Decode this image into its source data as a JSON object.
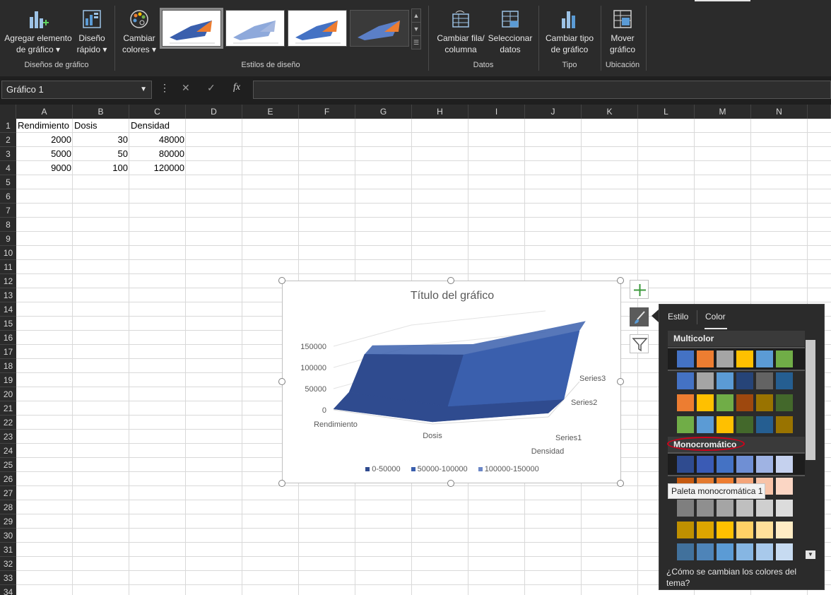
{
  "ribbon": {
    "buttons": {
      "add_element": "Agregar elemento\nde gráfico ▾",
      "add_element_l1": "Agregar elemento",
      "add_element_l2": "de gráfico ▾",
      "quick_layout_l1": "Diseño",
      "quick_layout_l2": "rápido ▾",
      "change_colors_l1": "Cambiar",
      "change_colors_l2": "colores ▾",
      "switch_row_l1": "Cambiar fila/",
      "switch_row_l2": "columna",
      "select_data_l1": "Seleccionar",
      "select_data_l2": "datos",
      "change_type_l1": "Cambiar tipo",
      "change_type_l2": "de gráfico",
      "move_chart_l1": "Mover",
      "move_chart_l2": "gráfico"
    },
    "groups": {
      "layouts": "Diseños de gráfico",
      "styles": "Estilos de diseño",
      "data": "Datos",
      "type": "Tipo",
      "location": "Ubicación"
    }
  },
  "formula_bar": {
    "name_box": "Gráfico 1",
    "more": "⋮",
    "cancel": "✕",
    "enter": "✓",
    "fx": "fx"
  },
  "sheet": {
    "columns": [
      "A",
      "B",
      "C",
      "D",
      "E",
      "F",
      "G",
      "H",
      "I",
      "J",
      "K",
      "L",
      "M",
      "N"
    ],
    "rows": [
      "1",
      "2",
      "3",
      "4",
      "5",
      "6",
      "7",
      "8",
      "9",
      "10",
      "11",
      "12",
      "13",
      "14",
      "15",
      "16",
      "17",
      "18",
      "19",
      "20",
      "21",
      "22",
      "23",
      "24",
      "25",
      "26",
      "27",
      "28",
      "29",
      "30",
      "31",
      "32",
      "33",
      "34"
    ],
    "header": [
      "Rendimiento",
      "Dosis",
      "Densidad"
    ],
    "data": [
      [
        "2000",
        "30",
        "48000"
      ],
      [
        "5000",
        "50",
        "80000"
      ],
      [
        "9000",
        "100",
        "120000"
      ]
    ]
  },
  "chart": {
    "title": "Título del gráfico",
    "y_ticks": [
      "150000",
      "100000",
      "50000",
      "0"
    ],
    "x_categories": [
      "Rendimiento",
      "Dosis",
      "Densidad"
    ],
    "depth_series": [
      "Series3",
      "Series2",
      "Series1"
    ],
    "legend": [
      "0-50000",
      "50000-100000",
      "100000-150000"
    ],
    "colors": {
      "band1": "#2f4b8f",
      "band2": "#3a5fad",
      "band3": "#6b87c7"
    }
  },
  "chart_data": {
    "type": "area",
    "title": "Título del gráfico",
    "categories": [
      "Rendimiento",
      "Dosis",
      "Densidad"
    ],
    "series": [
      {
        "name": "Series1",
        "values": [
          2000,
          5000,
          9000
        ]
      },
      {
        "name": "Series2",
        "values": [
          30,
          50,
          100
        ]
      },
      {
        "name": "Series3",
        "values": [
          48000,
          80000,
          120000
        ]
      }
    ],
    "ylim": [
      0,
      150000
    ],
    "legend_entries": [
      "0-50000",
      "50000-100000",
      "100000-150000"
    ],
    "legend_position": "bottom"
  },
  "color_panel": {
    "tab_style": "Estilo",
    "tab_color": "Color",
    "multicolor": "Multicolor",
    "monochrome": "Monocromático",
    "tooltip": "Paleta monocromática 1",
    "footer": "¿Cómo se cambian los colores del tema?",
    "multicolor_rows": [
      [
        "#4472c4",
        "#ed7d31",
        "#a5a5a5",
        "#ffc000",
        "#5b9bd5",
        "#70ad47"
      ],
      [
        "#4472c4",
        "#a5a5a5",
        "#5b9bd5",
        "#264478",
        "#636363",
        "#255e91"
      ],
      [
        "#ed7d31",
        "#ffc000",
        "#70ad47",
        "#9e480e",
        "#997300",
        "#43682b"
      ],
      [
        "#70ad47",
        "#5b9bd5",
        "#ffc000",
        "#43682b",
        "#255e91",
        "#997300"
      ]
    ],
    "mono_rows": [
      [
        "#2f4b8f",
        "#3a5bb5",
        "#4472c4",
        "#6f8fd4",
        "#9fb3e3",
        "#c5d1ee"
      ],
      [
        "#c55a11",
        "#e37a2f",
        "#ed7d31",
        "#f4a57a",
        "#f8c3a8",
        "#fbd6c4"
      ],
      [
        "#7f7f7f",
        "#8f8f8f",
        "#a5a5a5",
        "#bfbfbf",
        "#cfcfcf",
        "#dcdcdc"
      ],
      [
        "#bf9000",
        "#dda500",
        "#ffc000",
        "#ffd166",
        "#ffe09a",
        "#ffecc4"
      ],
      [
        "#41719c",
        "#4e84b8",
        "#5b9bd5",
        "#86b6e3",
        "#a8c9eb",
        "#c7dbf1"
      ]
    ]
  }
}
